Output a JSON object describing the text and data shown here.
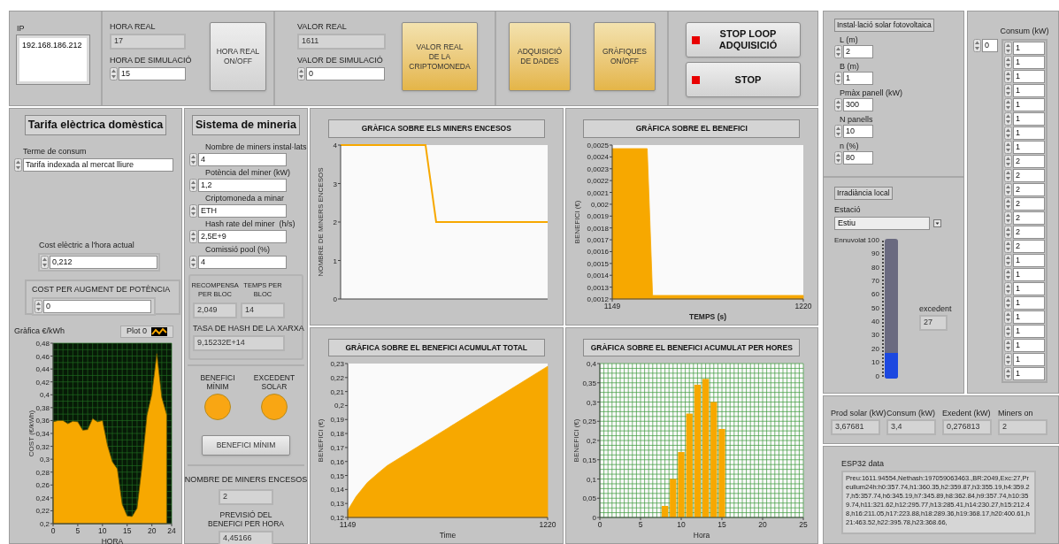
{
  "top_bar": {
    "ip": {
      "label": "IP",
      "value": "192.168.186.212"
    },
    "hora_real": {
      "label": "HORA REAL",
      "value": "17"
    },
    "hora_simulacio": {
      "label": "HORA DE SIMULACIÓ",
      "value": "15"
    },
    "hora_button": {
      "label": "HORA REAL\nON/OFF",
      "on": false
    },
    "valor_real": {
      "label": "VALOR REAL",
      "value": "1611"
    },
    "valor_simulacio": {
      "label": "VALOR DE SIMULACIÓ",
      "value": "0"
    },
    "buttons": [
      {
        "label": "VALOR REAL\nDE LA\nCRIPTOMONEDA",
        "on": true
      },
      {
        "label": "ADQUISICIÓ\nDE DADES",
        "on": true
      },
      {
        "label": "GRÀFIQUES\nON/OFF",
        "on": true
      }
    ],
    "stop_buttons": [
      {
        "label": "STOP LOOP ADQUISICIÓ",
        "on": true
      },
      {
        "label": "STOP",
        "on": true
      }
    ]
  },
  "tarifa": {
    "title": "Tarifa elèctrica domèstica",
    "terme": {
      "label": "Terme de consum",
      "value": "Tarifa indexada al mercat lliure"
    },
    "cost_actual": {
      "label": "Cost elèctric a l'hora actual",
      "value": "0,212"
    },
    "cost_augment": {
      "label": "COST PER AUGMENT DE POTÈNCIA",
      "value": "0"
    },
    "chart_label": "Gràfica €/kWh",
    "chart_data": {
      "type": "area",
      "grid": true,
      "xlabel": "HORA",
      "ylabel": "COST (€/kWh)",
      "x": [
        0,
        1,
        2,
        3,
        4,
        5,
        6,
        7,
        8,
        9,
        10,
        11,
        12,
        13,
        14,
        15,
        16,
        17,
        18,
        19,
        20,
        21,
        22,
        23
      ],
      "xlim": [
        0,
        24
      ],
      "ylim": [
        0.2,
        0.48
      ],
      "series": [
        {
          "name": "Plot 0",
          "color": "#f7a800",
          "values": [
            0.358,
            0.36,
            0.36,
            0.355,
            0.359,
            0.358,
            0.345,
            0.346,
            0.363,
            0.358,
            0.36,
            0.322,
            0.296,
            0.285,
            0.23,
            0.212,
            0.211,
            0.224,
            0.289,
            0.368,
            0.401,
            0.464,
            0.396,
            0.369
          ]
        }
      ],
      "xticks": [
        0,
        5,
        10,
        15,
        20,
        24
      ],
      "yticks": [
        {
          "value": 0.2,
          "label": "0,2"
        },
        {
          "value": 0.22,
          "label": "0,22"
        },
        {
          "value": 0.24,
          "label": "0,24"
        },
        {
          "value": 0.26,
          "label": "0,26"
        },
        {
          "value": 0.28,
          "label": "0,28"
        },
        {
          "value": 0.3,
          "label": "0,3"
        },
        {
          "value": 0.32,
          "label": "0,32"
        },
        {
          "value": 0.34,
          "label": "0,34"
        },
        {
          "value": 0.36,
          "label": "0,36"
        },
        {
          "value": 0.38,
          "label": "0,38"
        },
        {
          "value": 0.4,
          "label": "0,4"
        },
        {
          "value": 0.42,
          "label": "0,42"
        },
        {
          "value": 0.44,
          "label": "0,44"
        },
        {
          "value": 0.46,
          "label": "0,46"
        },
        {
          "value": 0.48,
          "label": "0,48"
        }
      ]
    }
  },
  "mineria": {
    "title": "Sistema de mineria",
    "inputs": [
      {
        "label": "Nombre de miners instal·lats",
        "value": "4"
      },
      {
        "label": "Potència del miner (kW)",
        "value": "1,2"
      },
      {
        "label": "Criptomoneda a minar",
        "value": "ETH"
      },
      {
        "label": "Hash rate del miner  (h/s)",
        "value": "2,5E+9"
      },
      {
        "label": "Comissió pool (%)",
        "value": "4"
      }
    ],
    "recompensa": {
      "label": "RECOMPENSA PER BLOC",
      "value": "2,049"
    },
    "temps": {
      "label": "TEMPS PER BLOC",
      "value": "14"
    },
    "tasa": {
      "label": "TASA DE HASH DE LA XARXA",
      "value": "9,15232E+14"
    },
    "leds": [
      {
        "label": "BENEFICI MÍNIM",
        "on": true
      },
      {
        "label": "EXCEDENT SOLAR",
        "on": true
      }
    ],
    "button": "BENEFICI MÍNIM",
    "miners_encesos": {
      "label": "NOMBRE DE MINERS ENCESOS",
      "value": "2"
    },
    "previsio": {
      "label": "PREVISIÓ DEL BENEFICI PER HORA",
      "value": "4,45166"
    }
  },
  "charts": [
    {
      "title": "GRÀFICA SOBRE ELS MINERS ENCESOS",
      "chart_data": {
        "type": "line",
        "ylabel": "NOMBRE DE MINERS ENCESOS",
        "categories": [
          null,
          null,
          null,
          null,
          null,
          null,
          null,
          null,
          null,
          null,
          null,
          null,
          null,
          null,
          null,
          null,
          null,
          null,
          null,
          null,
          null,
          null,
          null,
          null,
          null,
          null,
          null,
          null,
          null,
          null,
          null,
          null,
          null,
          null,
          null,
          null,
          null,
          null,
          null,
          null
        ],
        "ylim": [
          0,
          4
        ],
        "yticks": [
          0,
          1,
          2,
          3,
          4
        ],
        "series": [
          {
            "color": "#f7a800",
            "values": [
              4,
              4,
              4,
              4,
              4,
              4,
              4,
              4,
              4,
              4,
              4,
              4,
              4,
              4,
              4,
              4,
              4,
              3,
              2,
              2,
              2,
              2,
              2,
              2,
              2,
              2,
              2,
              2,
              2,
              2,
              2,
              2,
              2,
              2,
              2,
              2,
              2,
              2,
              2,
              2
            ]
          }
        ]
      }
    },
    {
      "title": "GRÀFICA SOBRE EL BENEFICI",
      "chart_data": {
        "type": "area",
        "xlabel": "TEMPS (s)",
        "ylabel": "BENEFICI (€)",
        "x": [
          1149,
          1162,
          1163,
          1164,
          1220
        ],
        "xlim": [
          1149,
          1220
        ],
        "ylim": [
          0.0012,
          0.0025
        ],
        "xticks": [
          1149,
          1220
        ],
        "yticks": [
          {
            "value": 0.0012,
            "label": "0,0012"
          },
          {
            "value": 0.0013,
            "label": "0,0013"
          },
          {
            "value": 0.0014,
            "label": "0,0014"
          },
          {
            "value": 0.0015,
            "label": "0,0015"
          },
          {
            "value": 0.0016,
            "label": "0,0016"
          },
          {
            "value": 0.0017,
            "label": "0,0017"
          },
          {
            "value": 0.0018,
            "label": "0,0018"
          },
          {
            "value": 0.0019,
            "label": "0,0019"
          },
          {
            "value": 0.002,
            "label": "0,002"
          },
          {
            "value": 0.0021,
            "label": "0,0021"
          },
          {
            "value": 0.0022,
            "label": "0,0022"
          },
          {
            "value": 0.0023,
            "label": "0,0023"
          },
          {
            "value": 0.0024,
            "label": "0,0024"
          },
          {
            "value": 0.0025,
            "label": "0,0025"
          }
        ],
        "series": [
          {
            "color": "#f7a800",
            "values": [
              0.00247,
              0.00247,
              0.00186,
              0.00123,
              0.00123
            ]
          }
        ]
      }
    },
    {
      "title": "GRÀFICA SOBRE EL BENEFICI ACUMULAT TOTAL",
      "chart_data": {
        "type": "area",
        "xlabel": "Time",
        "ylabel": "BENEFICI (€)",
        "x": [
          1149,
          1152,
          1156,
          1160,
          1163,
          1220
        ],
        "xlim": [
          1149,
          1220
        ],
        "ylim": [
          0.12,
          0.23
        ],
        "xticks": [
          1149,
          1220
        ],
        "yticks": [
          {
            "value": 0.12,
            "label": "0,12"
          },
          {
            "value": 0.13,
            "label": "0,13"
          },
          {
            "value": 0.14,
            "label": "0,14"
          },
          {
            "value": 0.15,
            "label": "0,15"
          },
          {
            "value": 0.16,
            "label": "0,16"
          },
          {
            "value": 0.17,
            "label": "0,17"
          },
          {
            "value": 0.18,
            "label": "0,18"
          },
          {
            "value": 0.19,
            "label": "0,19"
          },
          {
            "value": 0.2,
            "label": "0,2"
          },
          {
            "value": 0.21,
            "label": "0,21"
          },
          {
            "value": 0.22,
            "label": "0,22"
          },
          {
            "value": 0.23,
            "label": "0,23"
          }
        ],
        "series": [
          {
            "color": "#f7a800",
            "values": [
              0.125,
              0.135,
              0.145,
              0.152,
              0.157,
              0.228
            ]
          }
        ]
      }
    },
    {
      "title": "GRÀFICA SOBRE EL BENEFICI ACUMULAT PER HORES",
      "chart_data": {
        "type": "bar",
        "grid": true,
        "xlabel": "Hora",
        "ylabel": "BENEFICI (€)",
        "x": [
          8,
          9,
          10,
          11,
          12,
          13,
          14,
          15
        ],
        "xlim": [
          0,
          25
        ],
        "ylim": [
          0,
          0.4
        ],
        "xticks": [
          0,
          5,
          10,
          15,
          20,
          25
        ],
        "yticks": [
          {
            "value": 0,
            "label": "0"
          },
          {
            "value": 0.05,
            "label": "0,05"
          },
          {
            "value": 0.1,
            "label": "0,1"
          },
          {
            "value": 0.15,
            "label": "0,15"
          },
          {
            "value": 0.2,
            "label": "0,2"
          },
          {
            "value": 0.25,
            "label": "0,25"
          },
          {
            "value": 0.3,
            "label": "0,3"
          },
          {
            "value": 0.35,
            "label": "0,35"
          },
          {
            "value": 0.4,
            "label": "0,4"
          }
        ],
        "series": [
          {
            "color": "#f7a800",
            "values": [
              0.03,
              0.1,
              0.17,
              0.27,
              0.345,
              0.36,
              0.3,
              0.23
            ]
          }
        ]
      }
    }
  ],
  "solar": {
    "title": "Instal·lació solar fotovoltaica",
    "inputs": [
      {
        "label": "L (m)",
        "value": "2"
      },
      {
        "label": "B (m)",
        "value": "1"
      },
      {
        "label": "Pmàx panell (kW)",
        "value": "300"
      },
      {
        "label": "N panells",
        "value": "10"
      },
      {
        "label": "n (%)",
        "value": "80"
      }
    ]
  },
  "irradiancia": {
    "title": "Irradiància local",
    "estacio": {
      "label": "Estació",
      "value": "Estiu"
    },
    "gauge": {
      "label": "Ennuvolat",
      "level": 0.18,
      "ticks": [
        "100",
        "90",
        "80",
        "70",
        "60",
        "50",
        "40",
        "30",
        "20",
        "10",
        "0"
      ]
    },
    "excedent": {
      "label": "excedent",
      "value": "27"
    }
  },
  "consum": {
    "title": "Consum (kW)",
    "index": "0",
    "values": [
      "1",
      "1",
      "1",
      "1",
      "1",
      "1",
      "1",
      "1",
      "2",
      "2",
      "2",
      "2",
      "2",
      "2",
      "2",
      "1",
      "1",
      "1",
      "1",
      "1",
      "1",
      "1",
      "1",
      "1"
    ]
  },
  "stats": [
    {
      "label": "Prod solar (kW)",
      "value": "3,67681"
    },
    {
      "label": "Consum (kW)",
      "value": "3,4"
    },
    {
      "label": "Exedent (kW)",
      "value": "0,276813"
    },
    {
      "label": "Miners on",
      "value": "2"
    }
  ],
  "esp32": {
    "label": "ESP32 data",
    "value": "Preu:1611.94554,Nethash:197059063463.,BR:2049,Exc:27,Preullum24h:h0:357.74,h1:360.35,h2:359.87,h3:355.19,h4:359.27,h5:357.74,h6:345.19,h7:345.89,h8:362.84,h9:357.74,h10:359.74,h11:321.62,h12:295.77,h13:285.41,h14:230.27,h15:212.48,h16:211.05,h17:223.88,h18:289.36,h19:368.17,h20:400.61,h21:463.52,h22:395.78,h23:368.66,"
  }
}
